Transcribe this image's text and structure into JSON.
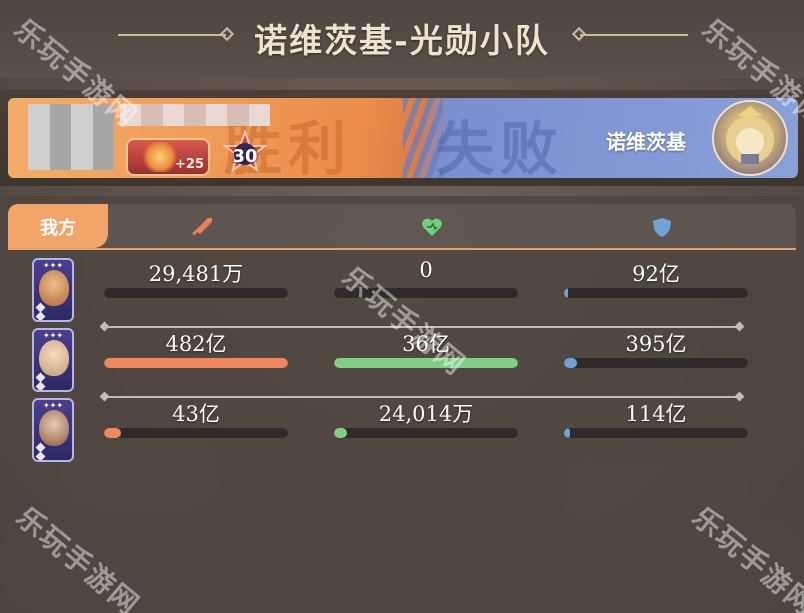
{
  "title": "诺维茨基-光勋小队",
  "banner": {
    "win_label": "胜利",
    "lose_label": "失败",
    "weapon_level": "+25",
    "player_level": "30",
    "opponent_name": "诺维茨基"
  },
  "tabs": {
    "mine": "我方",
    "icons": [
      "sword-icon",
      "heart-icon",
      "shield-icon"
    ]
  },
  "colors": {
    "damage": "#f0875e",
    "heal": "#7fcf84",
    "defense": "#6fa2d6",
    "win": "#ef9a52",
    "lose": "#8aa0d8"
  },
  "rows": [
    {
      "hero": "hero-1",
      "damage": {
        "value": "29,481万",
        "fill": 0.0
      },
      "heal": {
        "value": "0",
        "fill": 0.0
      },
      "defense": {
        "value": "92亿",
        "fill": 0.02
      }
    },
    {
      "hero": "hero-2",
      "damage": {
        "value": "482亿",
        "fill": 1.0
      },
      "heal": {
        "value": "36亿",
        "fill": 1.0
      },
      "defense": {
        "value": "395亿",
        "fill": 0.07
      }
    },
    {
      "hero": "hero-3",
      "damage": {
        "value": "43亿",
        "fill": 0.09
      },
      "heal": {
        "value": "24,014万",
        "fill": 0.07
      },
      "defense": {
        "value": "114亿",
        "fill": 0.03
      }
    }
  ],
  "watermark": "乐玩手游网"
}
